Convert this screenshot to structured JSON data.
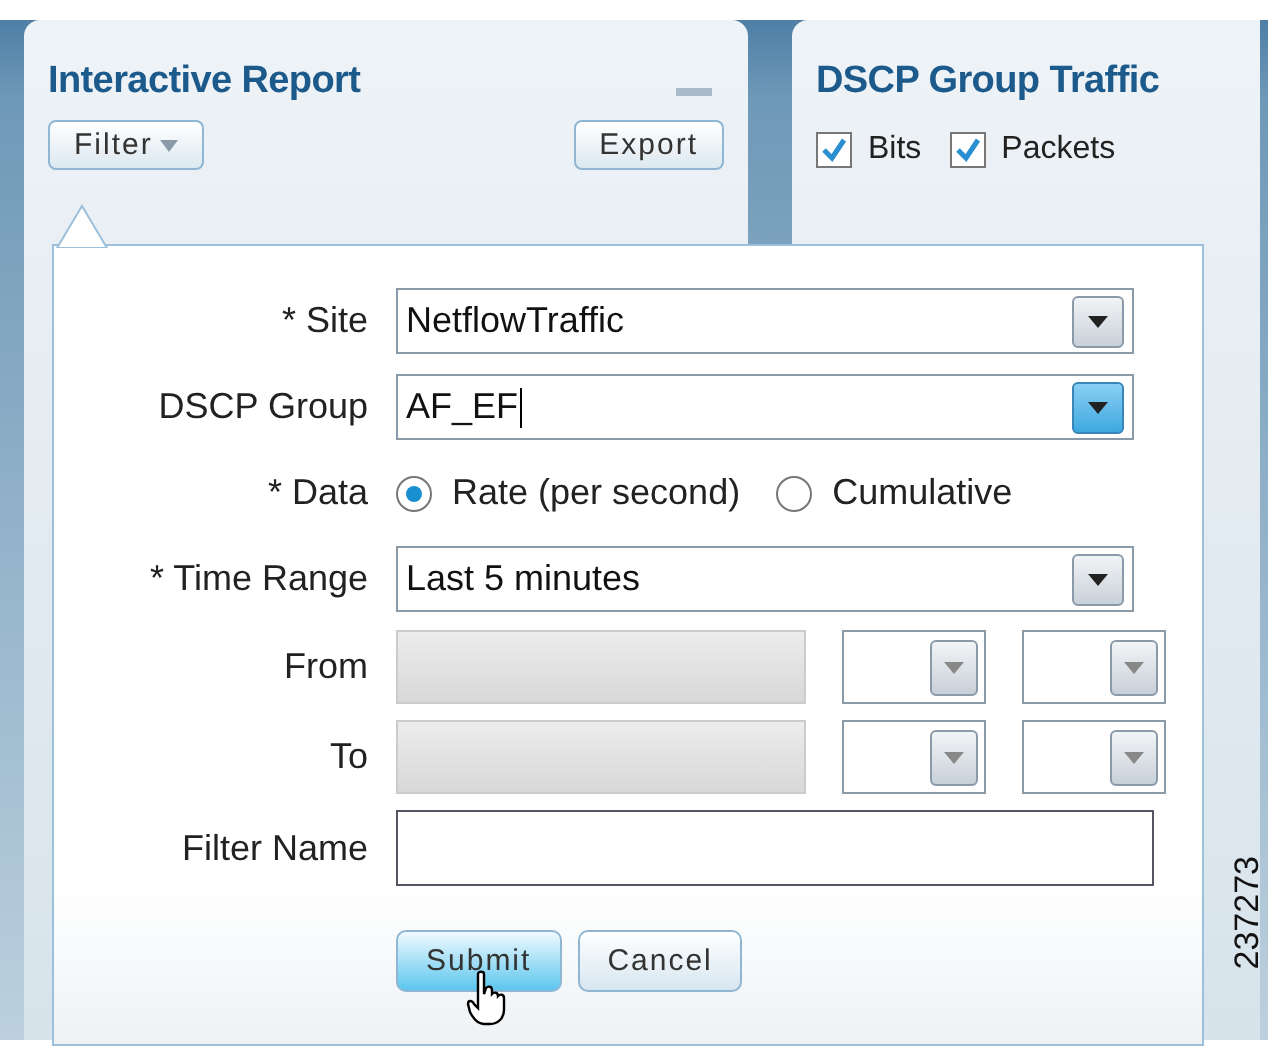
{
  "report_panel": {
    "title": "Interactive Report",
    "filter_button": "Filter",
    "export_button": "Export"
  },
  "traffic_panel": {
    "title": "DSCP Group Traffic",
    "checkboxes": [
      {
        "label": "Bits",
        "checked": true
      },
      {
        "label": "Packets",
        "checked": true
      }
    ]
  },
  "filter_popup": {
    "rows": [
      {
        "kind": "select",
        "label": "* Site",
        "value": "NetflowTraffic",
        "focused": false
      },
      {
        "kind": "select",
        "label": "DSCP Group",
        "value": "AF_EF",
        "focused": true
      },
      {
        "kind": "radio",
        "label": "* Data",
        "options": [
          {
            "label": "Rate (per second)",
            "selected": true
          },
          {
            "label": "Cumulative",
            "selected": false
          }
        ]
      },
      {
        "kind": "select",
        "label": "* Time Range",
        "value": "Last 5 minutes",
        "focused": false
      },
      {
        "kind": "datetime",
        "label": "From",
        "disabled": true
      },
      {
        "kind": "datetime",
        "label": "To",
        "disabled": true
      },
      {
        "kind": "text",
        "label": "Filter Name"
      }
    ],
    "buttons": [
      {
        "label": "Submit",
        "hovered": true
      },
      {
        "label": "Cancel",
        "hovered": false
      }
    ]
  },
  "figure_number": "237273"
}
